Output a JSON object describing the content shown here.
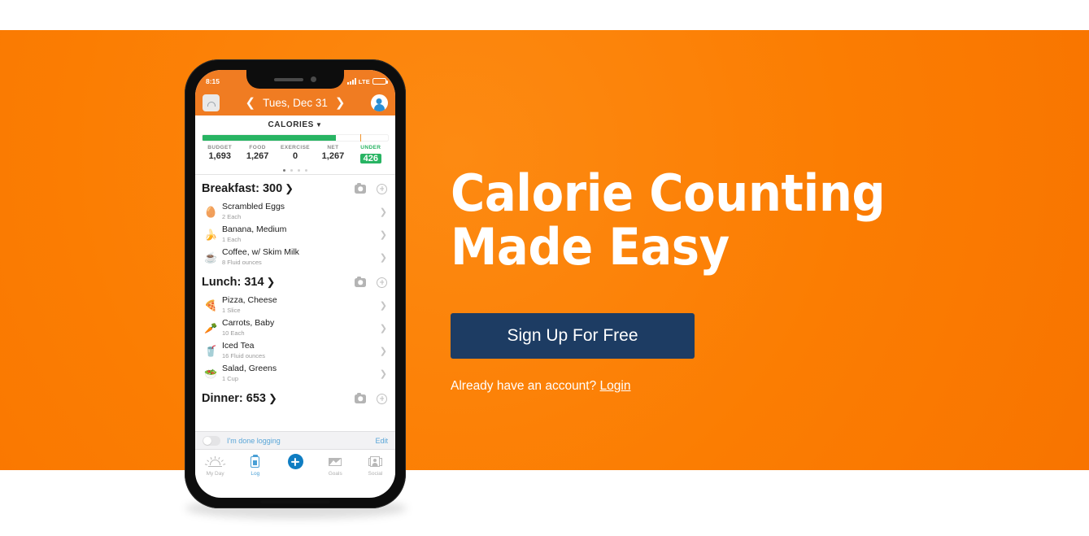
{
  "theme": {
    "brand_orange": "#fb7d02",
    "header_orange": "#f07c22",
    "cta_navy": "#1d3c63",
    "accent_green": "#28b463",
    "accent_blue": "#4a9fd5",
    "tick_orange": "#f0932b"
  },
  "marketing": {
    "headline_line1": "Calorie Counting",
    "headline_line2": "Made Easy",
    "signup_label": "Sign Up For Free",
    "login_prompt": "Already have an account?",
    "login_label": "Login"
  },
  "phone": {
    "status_bar": {
      "time": "8:15",
      "network": "LTE",
      "signal_icon": "signal-bars-icon",
      "battery_icon": "battery-icon"
    },
    "app_header": {
      "scale_icon": "scale-icon",
      "prev_icon": "chevron-left-icon",
      "date": "Tues, Dec 31",
      "next_icon": "chevron-right-icon",
      "avatar_icon": "avatar-icon"
    },
    "summary": {
      "title": "CALORIES",
      "caret_icon": "chevron-down-icon",
      "progress_percent": 72,
      "tick_percent": 85,
      "stats": [
        {
          "label": "BUDGET",
          "value": "1,693"
        },
        {
          "label": "FOOD",
          "value": "1,267"
        },
        {
          "label": "EXERCISE",
          "value": "0"
        },
        {
          "label": "NET",
          "value": "1,267"
        },
        {
          "label": "UNDER",
          "value": "426",
          "highlight": true
        }
      ],
      "page_dots": 4,
      "active_dot": 0
    },
    "meals": [
      {
        "name": "Breakfast",
        "calories": "300",
        "title": "Breakfast: 300",
        "camera_icon": "camera-icon",
        "add_icon": "add-circle-icon",
        "items": [
          {
            "emoji": "🥚",
            "icon": "egg-icon",
            "name": "Scrambled Eggs",
            "qty": "2 Each"
          },
          {
            "emoji": "🍌",
            "icon": "banana-icon",
            "name": "Banana, Medium",
            "qty": "1 Each"
          },
          {
            "emoji": "☕",
            "icon": "coffee-icon",
            "name": "Coffee, w/ Skim Milk",
            "qty": "8 Fluid ounces"
          }
        ]
      },
      {
        "name": "Lunch",
        "calories": "314",
        "title": "Lunch: 314",
        "camera_icon": "camera-icon",
        "add_icon": "add-circle-icon",
        "items": [
          {
            "emoji": "🍕",
            "icon": "pizza-icon",
            "name": "Pizza, Cheese",
            "qty": "1 Slice"
          },
          {
            "emoji": "🥕",
            "icon": "carrot-icon",
            "name": "Carrots, Baby",
            "qty": "10 Each"
          },
          {
            "emoji": "🥤",
            "icon": "iced-tea-icon",
            "name": "Iced Tea",
            "qty": "16 Fluid ounces"
          },
          {
            "emoji": "🥗",
            "icon": "salad-icon",
            "name": "Salad, Greens",
            "qty": "1 Cup"
          }
        ]
      },
      {
        "name": "Dinner",
        "calories": "653",
        "title": "Dinner: 653",
        "camera_icon": "camera-icon",
        "add_icon": "add-circle-icon",
        "items": []
      }
    ],
    "done_bar": {
      "toggle_state": "off",
      "label": "I'm done logging",
      "edit_label": "Edit"
    },
    "tab_bar": [
      {
        "label": "My Day",
        "icon": "sunrise-icon",
        "active": false
      },
      {
        "label": "Log",
        "icon": "clipboard-icon",
        "active": true
      },
      {
        "label": "",
        "icon": "add-button-icon",
        "active": false
      },
      {
        "label": "Goals",
        "icon": "chart-icon",
        "active": false
      },
      {
        "label": "Social",
        "icon": "social-icon",
        "active": false
      }
    ]
  }
}
